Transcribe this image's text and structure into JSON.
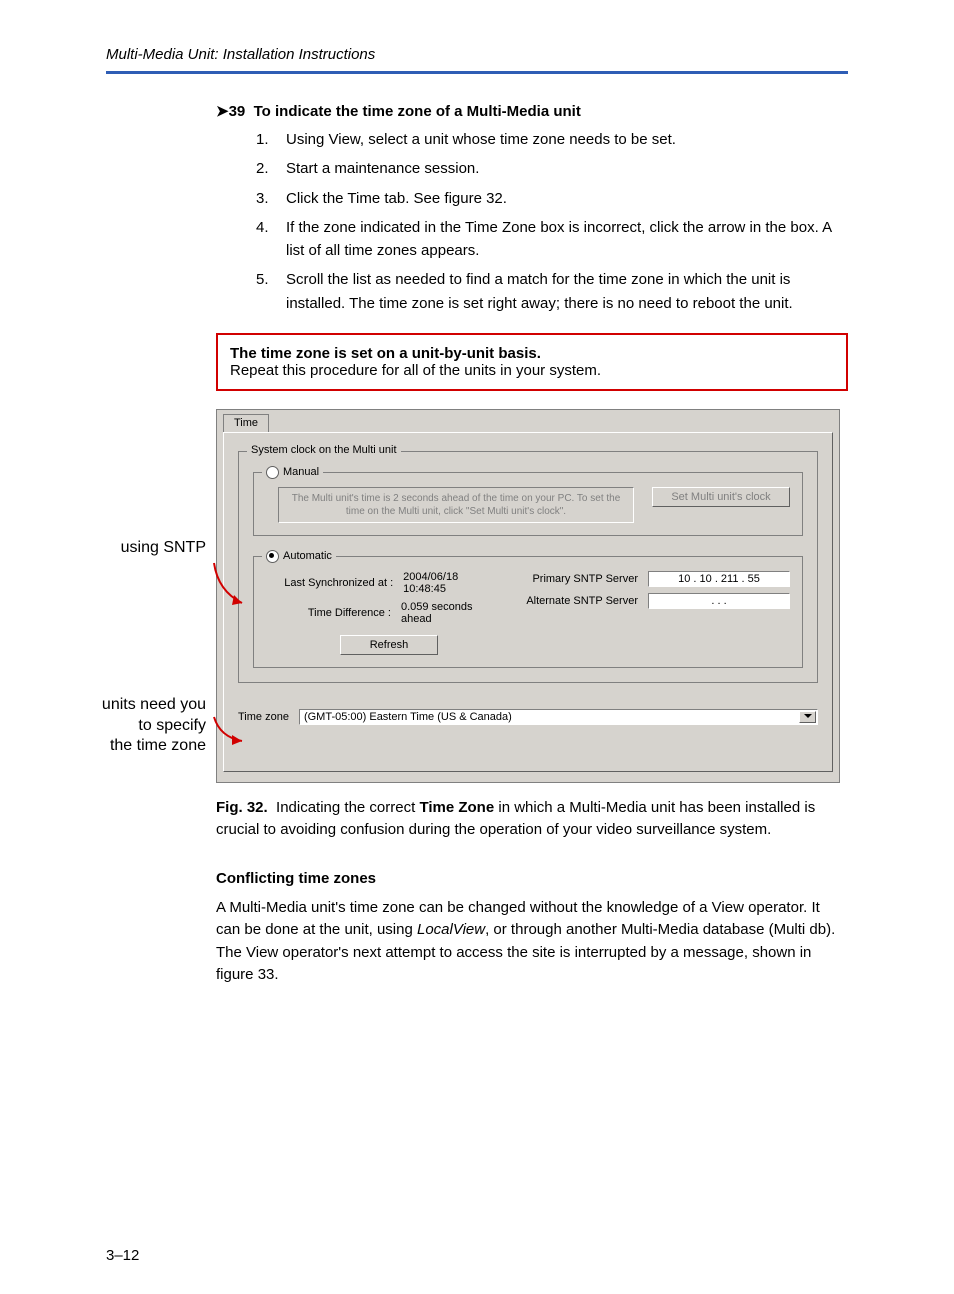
{
  "header": {
    "title": "Multi-Media Unit: Installation Instructions"
  },
  "section": {
    "number": "39",
    "title": "To indicate the time zone of a Multi-Media unit",
    "steps": [
      "Using View, select a unit whose time zone needs to be set.",
      "Start a maintenance session.",
      "Click the Time tab. See figure 32.",
      "If the zone indicated in the Time Zone box is incorrect, click the arrow in the box. A list of all time zones appears.",
      "Scroll the list as needed to find a match for the time zone in which the unit is installed. The time zone is set right away; there is no need to reboot the unit."
    ]
  },
  "note": {
    "bold": "The time zone is set on a unit-by-unit basis.",
    "text": "Repeat this procedure for all of the units in your system."
  },
  "margin_labels": {
    "sntp": "using SNTP",
    "tz1": "units need you",
    "tz2": "to specify",
    "tz3": "the time zone"
  },
  "screenshot": {
    "tab": "Time",
    "group_title": "System clock on the Multi unit",
    "manual_label": "Manual",
    "manual_text": "The Multi unit's time is 2 seconds ahead of the time on your PC. To set the time on the Multi unit, click \"Set Multi unit's clock\".",
    "set_clock_btn": "Set Multi unit's clock",
    "auto_label": "Automatic",
    "last_sync_label": "Last Synchronized at :",
    "last_sync_val": "2004/06/18  10:48:45",
    "diff_label": "Time Difference :",
    "diff_val": "0.059 seconds ahead",
    "refresh_btn": "Refresh",
    "primary_label": "Primary SNTP Server",
    "primary_val": "10  .  10  . 211  .  55",
    "alt_label": "Alternate SNTP Server",
    "alt_val": ".        .        .",
    "tz_label": "Time zone",
    "tz_value": "(GMT-05:00) Eastern Time (US & Canada)"
  },
  "caption": {
    "prefix": "Fig. 32.",
    "part1": "Indicating the correct ",
    "bold": "Time Zone",
    "part2": " in which a Multi-Media unit has been installed is crucial to avoiding confusion during the operation of your video surveillance system."
  },
  "conflict": {
    "heading": "Conflicting time zones",
    "para_a": "A Multi-Media unit's time zone can be changed without the knowledge of a View operator. It can be done at the unit, using ",
    "italic": "LocalView",
    "para_b": ", or through another Multi-Media database (Multi db). The View operator's next attempt to access the site is interrupted by a message, shown in figure 33."
  },
  "footer": {
    "pagenum": "3–12"
  }
}
